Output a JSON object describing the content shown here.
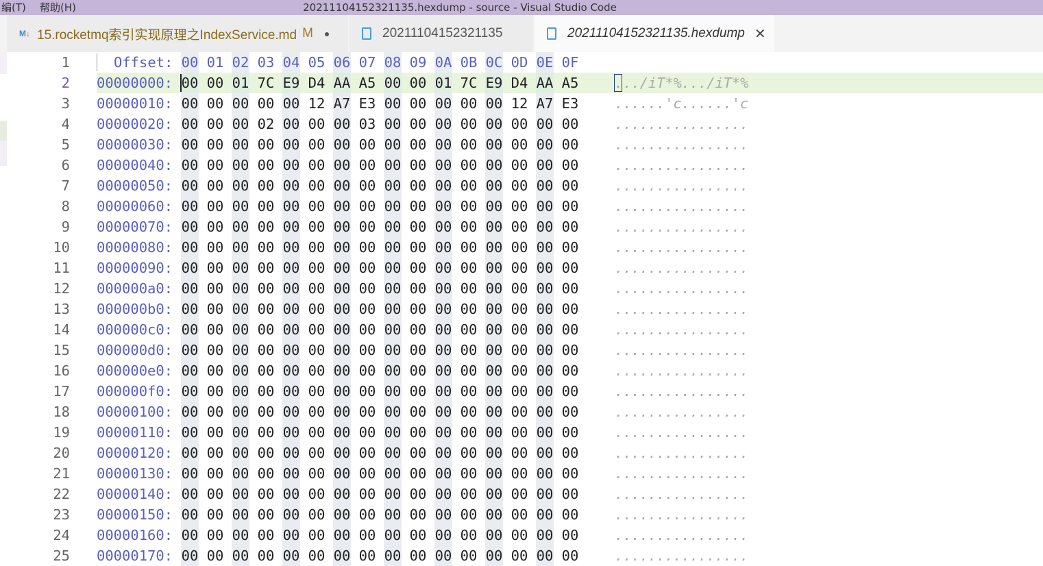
{
  "titlebar": {
    "menu_edit": "编(T)",
    "menu_help": "帮助(H)",
    "title": "20211104152321135.hexdump - source - Visual Studio Code"
  },
  "tabs": [
    {
      "icon": "markdown-icon",
      "label": "15.rocketmq索引实现原理之IndexService.md",
      "badge": "M",
      "modified": true
    },
    {
      "icon": "file-icon",
      "label": "20211104152321135"
    },
    {
      "icon": "file-icon",
      "label": "20211104152321135.hexdump",
      "active": true
    }
  ],
  "markdown_icon_text": "M↓",
  "header": {
    "line": "1",
    "label": "Offset:",
    "cols": [
      "00",
      "01",
      "02",
      "03",
      "04",
      "05",
      "06",
      "07",
      "08",
      "09",
      "0A",
      "0B",
      "0C",
      "0D",
      "0E",
      "0F"
    ]
  },
  "rows": [
    {
      "line": "2",
      "offset": "00000000:",
      "bytes": "00 00 01 7C E9 D4 AA A5 00 00 01 7C E9 D4 AA A5",
      "ascii": "../iT*%.../iT*%"
    },
    {
      "line": "3",
      "offset": "00000010:",
      "bytes": "00 00 00 00 00 12 A7 E3 00 00 00 00 00 12 A7 E3",
      "ascii": "......'c......'c"
    },
    {
      "line": "4",
      "offset": "00000020:",
      "bytes": "00 00 00 02 00 00 00 03 00 00 00 00 00 00 00 00",
      "ascii": "................"
    },
    {
      "line": "5",
      "offset": "00000030:",
      "bytes": "00 00 00 00 00 00 00 00 00 00 00 00 00 00 00 00",
      "ascii": "................"
    },
    {
      "line": "6",
      "offset": "00000040:",
      "bytes": "00 00 00 00 00 00 00 00 00 00 00 00 00 00 00 00",
      "ascii": "................"
    },
    {
      "line": "7",
      "offset": "00000050:",
      "bytes": "00 00 00 00 00 00 00 00 00 00 00 00 00 00 00 00",
      "ascii": "................"
    },
    {
      "line": "8",
      "offset": "00000060:",
      "bytes": "00 00 00 00 00 00 00 00 00 00 00 00 00 00 00 00",
      "ascii": "................"
    },
    {
      "line": "9",
      "offset": "00000070:",
      "bytes": "00 00 00 00 00 00 00 00 00 00 00 00 00 00 00 00",
      "ascii": "................"
    },
    {
      "line": "10",
      "offset": "00000080:",
      "bytes": "00 00 00 00 00 00 00 00 00 00 00 00 00 00 00 00",
      "ascii": "................"
    },
    {
      "line": "11",
      "offset": "00000090:",
      "bytes": "00 00 00 00 00 00 00 00 00 00 00 00 00 00 00 00",
      "ascii": "................"
    },
    {
      "line": "12",
      "offset": "000000a0:",
      "bytes": "00 00 00 00 00 00 00 00 00 00 00 00 00 00 00 00",
      "ascii": "................"
    },
    {
      "line": "13",
      "offset": "000000b0:",
      "bytes": "00 00 00 00 00 00 00 00 00 00 00 00 00 00 00 00",
      "ascii": "................"
    },
    {
      "line": "14",
      "offset": "000000c0:",
      "bytes": "00 00 00 00 00 00 00 00 00 00 00 00 00 00 00 00",
      "ascii": "................"
    },
    {
      "line": "15",
      "offset": "000000d0:",
      "bytes": "00 00 00 00 00 00 00 00 00 00 00 00 00 00 00 00",
      "ascii": "................"
    },
    {
      "line": "16",
      "offset": "000000e0:",
      "bytes": "00 00 00 00 00 00 00 00 00 00 00 00 00 00 00 00",
      "ascii": "................"
    },
    {
      "line": "17",
      "offset": "000000f0:",
      "bytes": "00 00 00 00 00 00 00 00 00 00 00 00 00 00 00 00",
      "ascii": "................"
    },
    {
      "line": "18",
      "offset": "00000100:",
      "bytes": "00 00 00 00 00 00 00 00 00 00 00 00 00 00 00 00",
      "ascii": "................"
    },
    {
      "line": "19",
      "offset": "00000110:",
      "bytes": "00 00 00 00 00 00 00 00 00 00 00 00 00 00 00 00",
      "ascii": "................"
    },
    {
      "line": "20",
      "offset": "00000120:",
      "bytes": "00 00 00 00 00 00 00 00 00 00 00 00 00 00 00 00",
      "ascii": "................"
    },
    {
      "line": "21",
      "offset": "00000130:",
      "bytes": "00 00 00 00 00 00 00 00 00 00 00 00 00 00 00 00",
      "ascii": "................"
    },
    {
      "line": "22",
      "offset": "00000140:",
      "bytes": "00 00 00 00 00 00 00 00 00 00 00 00 00 00 00 00",
      "ascii": "................"
    },
    {
      "line": "23",
      "offset": "00000150:",
      "bytes": "00 00 00 00 00 00 00 00 00 00 00 00 00 00 00 00",
      "ascii": "................"
    },
    {
      "line": "24",
      "offset": "00000160:",
      "bytes": "00 00 00 00 00 00 00 00 00 00 00 00 00 00 00 00",
      "ascii": "................"
    },
    {
      "line": "25",
      "offset": "00000170:",
      "bytes": "00 00 00 00 00 00 00 00 00 00 00 00 00 00 00 00",
      "ascii": "................"
    }
  ],
  "colors": {
    "titlebar": "#c5b5d8",
    "offset": "#5a60c0",
    "current_line": "#e8f5dc"
  }
}
